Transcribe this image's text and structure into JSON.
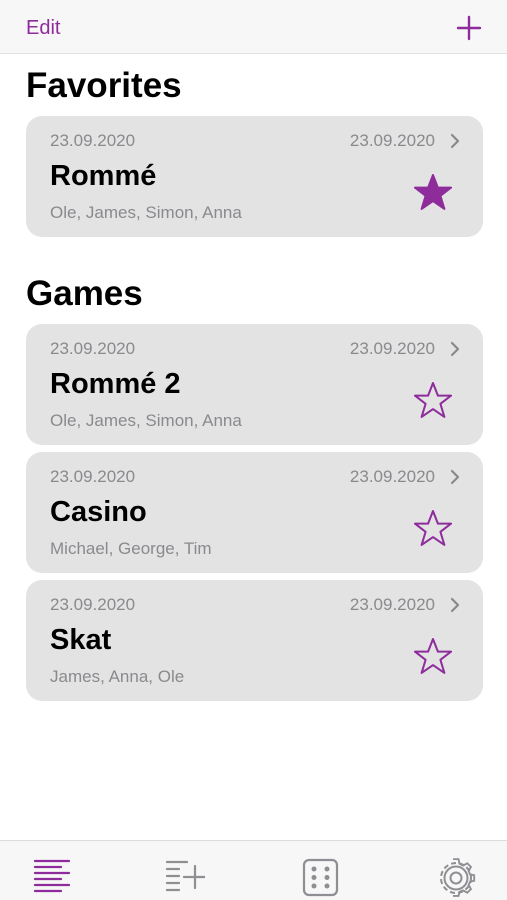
{
  "nav": {
    "edit_label": "Edit",
    "add_icon": "plus-icon"
  },
  "sections": {
    "favorites_title": "Favorites",
    "games_title": "Games"
  },
  "favorites": [
    {
      "date_left": "23.09.2020",
      "date_right": "23.09.2020",
      "title": "Rommé",
      "players": "Ole, James, Simon, Anna",
      "favorite": true
    }
  ],
  "games": [
    {
      "date_left": "23.09.2020",
      "date_right": "23.09.2020",
      "title": "Rommé 2",
      "players": "Ole, James, Simon, Anna",
      "favorite": false
    },
    {
      "date_left": "23.09.2020",
      "date_right": "23.09.2020",
      "title": "Casino",
      "players": "Michael, George, Tim",
      "favorite": false
    },
    {
      "date_left": "23.09.2020",
      "date_right": "23.09.2020",
      "title": "Skat",
      "players": "James, Anna, Ole",
      "favorite": false
    }
  ],
  "tabbar": {
    "tabs": [
      {
        "icon": "list-icon",
        "active": true
      },
      {
        "icon": "add-list-icon",
        "active": false
      },
      {
        "icon": "dice-icon",
        "active": false
      },
      {
        "icon": "gear-icon",
        "active": false
      }
    ]
  },
  "colors": {
    "accent": "#8e2c9b",
    "card_background": "#e3e3e3",
    "secondary_text": "#8a8a8e",
    "inactive_icon": "#8e8e93"
  }
}
